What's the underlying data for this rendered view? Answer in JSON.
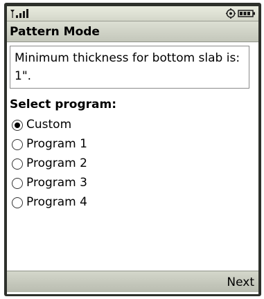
{
  "status_bar": {
    "signal_icon": "signal-strength-icon",
    "settings_icon": "network-activity-icon",
    "battery_icon": "battery-icon"
  },
  "header": {
    "title": "Pattern Mode"
  },
  "message": {
    "text": "Minimum thickness for bottom slab is: 1\"."
  },
  "program_select": {
    "label": "Select program:",
    "selected": "Custom",
    "options": [
      {
        "label": "Custom",
        "checked": true
      },
      {
        "label": "Program 1",
        "checked": false
      },
      {
        "label": "Program 2",
        "checked": false
      },
      {
        "label": "Program 3",
        "checked": false
      },
      {
        "label": "Program 4",
        "checked": false
      }
    ]
  },
  "softkeys": {
    "right": "Next"
  }
}
